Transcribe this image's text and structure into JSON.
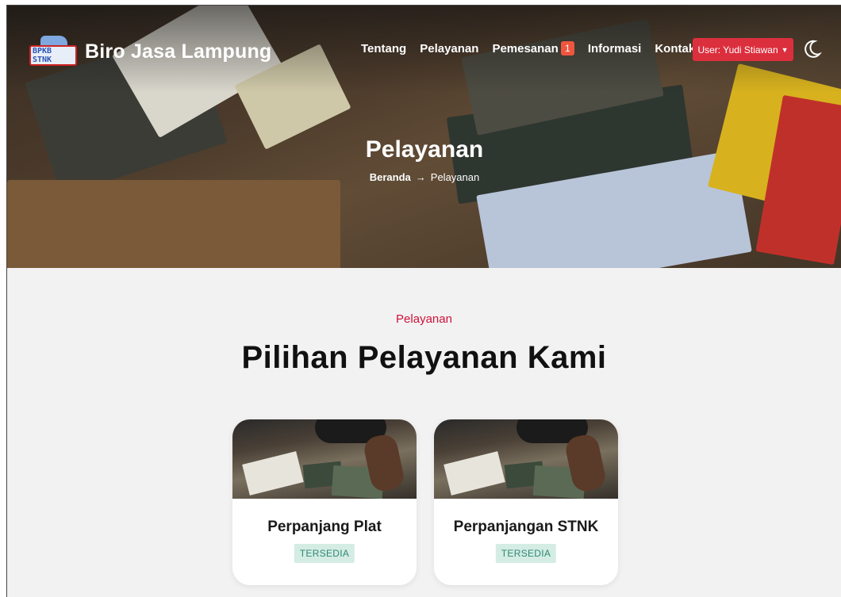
{
  "brand": {
    "name": "Biro Jasa Lampung",
    "logo_text": "BPKB STNK"
  },
  "nav": {
    "items": [
      {
        "label": "Tentang"
      },
      {
        "label": "Pelayanan"
      },
      {
        "label": "Pemesanan",
        "badge": "1"
      },
      {
        "label": "Informasi"
      },
      {
        "label": "Kontak"
      }
    ],
    "user_button": "User: Yudi Stiawan",
    "theme_icon": "moon-icon"
  },
  "hero": {
    "title": "Pelayanan",
    "breadcrumb": {
      "home": "Beranda",
      "separator": "→",
      "current": "Pelayanan"
    }
  },
  "section": {
    "kicker": "Pelayanan",
    "title": "Pilihan Pelayanan Kami"
  },
  "services": [
    {
      "name": "Perpanjang Plat",
      "status": "TERSEDIA"
    },
    {
      "name": "Perpanjangan STNK",
      "status": "TERSEDIA"
    }
  ],
  "colors": {
    "accent": "#dc2f3e",
    "kicker": "#d0103a",
    "badge": "#f0563f",
    "status_bg": "#d4ece4",
    "status_text": "#2f8a72"
  }
}
